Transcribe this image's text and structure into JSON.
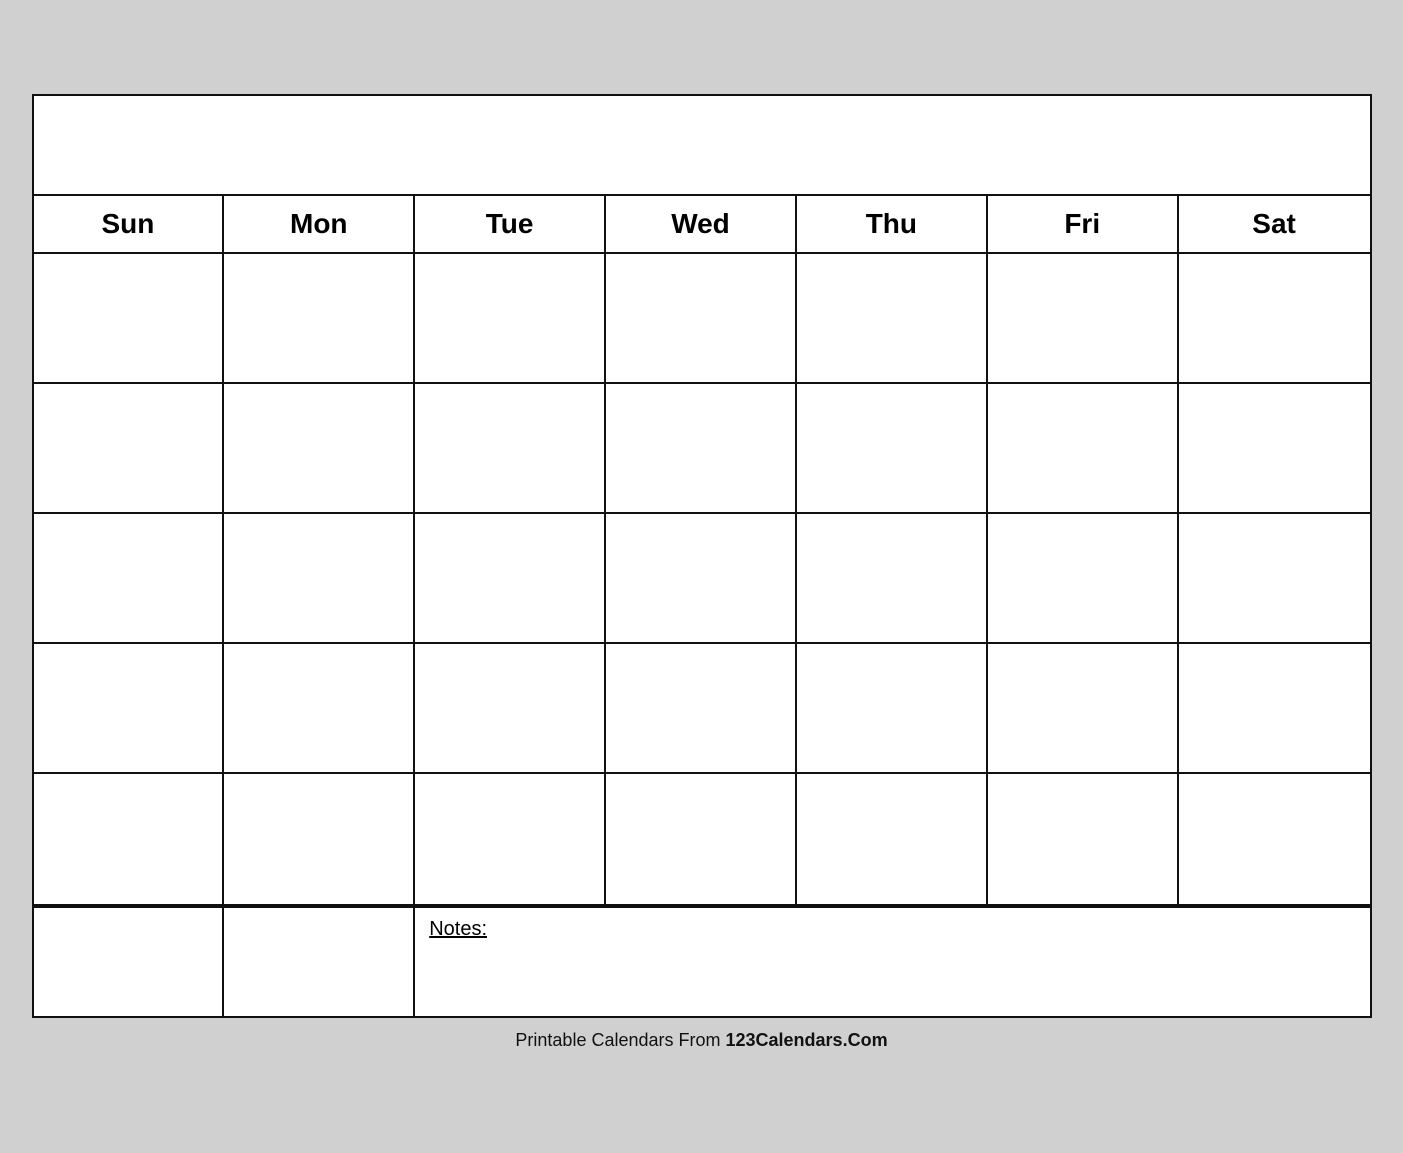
{
  "calendar": {
    "title": "",
    "days": [
      "Sun",
      "Mon",
      "Tue",
      "Wed",
      "Thu",
      "Fri",
      "Sat"
    ],
    "rows": 5,
    "notes_label": "Notes:"
  },
  "footer": {
    "text_plain": "Printable Calendars From ",
    "text_bold": "123Calendars.Com"
  }
}
